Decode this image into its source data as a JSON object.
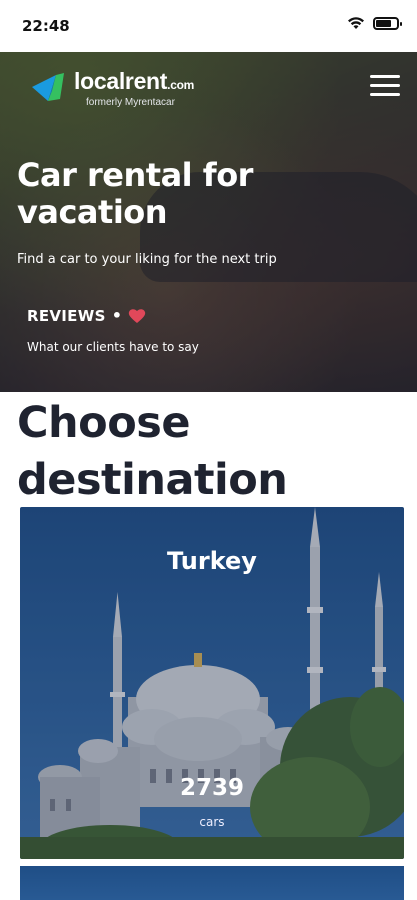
{
  "status_bar": {
    "time": "22:48"
  },
  "header": {
    "logo_name": "localrent",
    "logo_tld": ".com",
    "logo_sub": "formerly Myrentacar"
  },
  "hero": {
    "title": "Car rental for vacation",
    "subtitle": "Find a car to your liking for the next trip",
    "reviews_title": "REVIEWS",
    "reviews_dot": "•",
    "reviews_sub": "What our clients have to say",
    "heart_color": "#e0485a"
  },
  "destinations": {
    "title": "Choose destination",
    "cards": [
      {
        "name": "Turkey",
        "count": "2739",
        "unit": "cars"
      }
    ]
  },
  "colors": {
    "logo_blue": "#1a9be0",
    "logo_green": "#35c060",
    "card_blue": "#2a5c96"
  }
}
